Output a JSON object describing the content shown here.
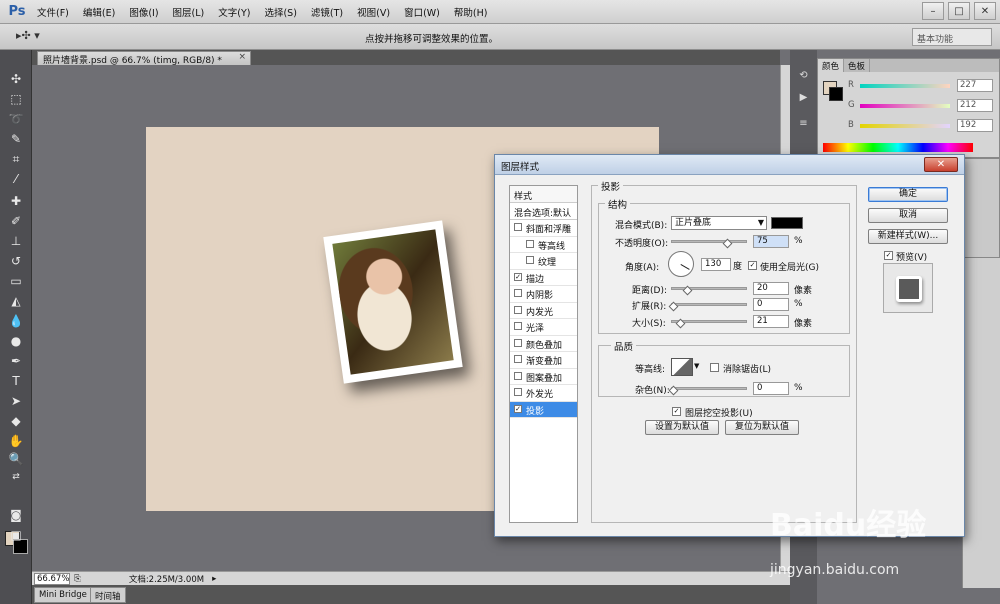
{
  "menubar": {
    "logo": "Ps",
    "items": [
      "文件(F)",
      "编辑(E)",
      "图像(I)",
      "图层(L)",
      "文字(Y)",
      "选择(S)",
      "滤镜(T)",
      "视图(V)",
      "窗口(W)",
      "帮助(H)"
    ]
  },
  "optbar": {
    "hint": "点按并拖移可调整效果的位置。",
    "workspace": "基本功能"
  },
  "document": {
    "tab_title": "照片墙背景.psd @ 66.7% (timg, RGB/8) *"
  },
  "statusbar": {
    "zoom": "66.67%",
    "doc_size": "文档:2.25M/3.00M"
  },
  "bottom_tabs": [
    "Mini Bridge",
    "时间轴"
  ],
  "color_panel": {
    "tabs": [
      "颜色",
      "色板"
    ],
    "r_label": "R",
    "g_label": "G",
    "b_label": "B",
    "r": "227",
    "g": "212",
    "b": "192",
    "foreground_color": "#e3d4c0"
  },
  "dialog": {
    "title": "图层样式",
    "styles_header": "样式",
    "blend_options": "混合选项:默认",
    "styles": [
      {
        "label": "斜面和浮雕",
        "checked": false,
        "indent": false,
        "selected": false
      },
      {
        "label": "等高线",
        "checked": false,
        "indent": true,
        "selected": false
      },
      {
        "label": "纹理",
        "checked": false,
        "indent": true,
        "selected": false
      },
      {
        "label": "描边",
        "checked": true,
        "indent": false,
        "selected": false
      },
      {
        "label": "内阴影",
        "checked": false,
        "indent": false,
        "selected": false
      },
      {
        "label": "内发光",
        "checked": false,
        "indent": false,
        "selected": false
      },
      {
        "label": "光泽",
        "checked": false,
        "indent": false,
        "selected": false
      },
      {
        "label": "颜色叠加",
        "checked": false,
        "indent": false,
        "selected": false
      },
      {
        "label": "渐变叠加",
        "checked": false,
        "indent": false,
        "selected": false
      },
      {
        "label": "图案叠加",
        "checked": false,
        "indent": false,
        "selected": false
      },
      {
        "label": "外发光",
        "checked": false,
        "indent": false,
        "selected": false
      },
      {
        "label": "投影",
        "checked": true,
        "indent": false,
        "selected": true
      }
    ],
    "section_title": "投影",
    "structure": {
      "title": "结构",
      "blend_mode_label": "混合模式(B):",
      "blend_mode_value": "正片叠底",
      "opacity_label": "不透明度(O):",
      "opacity_value": "75",
      "angle_label": "角度(A):",
      "angle_value": "130",
      "degree_unit": "度",
      "global_light_label": "使用全局光(G)",
      "distance_label": "距离(D):",
      "distance_value": "20",
      "spread_label": "扩展(R):",
      "spread_value": "0",
      "size_label": "大小(S):",
      "size_value": "21",
      "pixel_unit": "像素",
      "percent_unit": "%"
    },
    "quality": {
      "title": "品质",
      "contour_label": "等高线:",
      "antialias_label": "消除锯齿(L)",
      "noise_label": "杂色(N):",
      "noise_value": "0"
    },
    "knockout_label": "图层挖空投影(U)",
    "make_default": "设置为默认值",
    "reset_default": "复位为默认值",
    "ok": "确定",
    "cancel": "取消",
    "new_style": "新建样式(W)...",
    "preview_label": "预览(V)"
  },
  "watermark": {
    "main": "Baidu经验",
    "sub": "jingyan.baidu.com"
  }
}
